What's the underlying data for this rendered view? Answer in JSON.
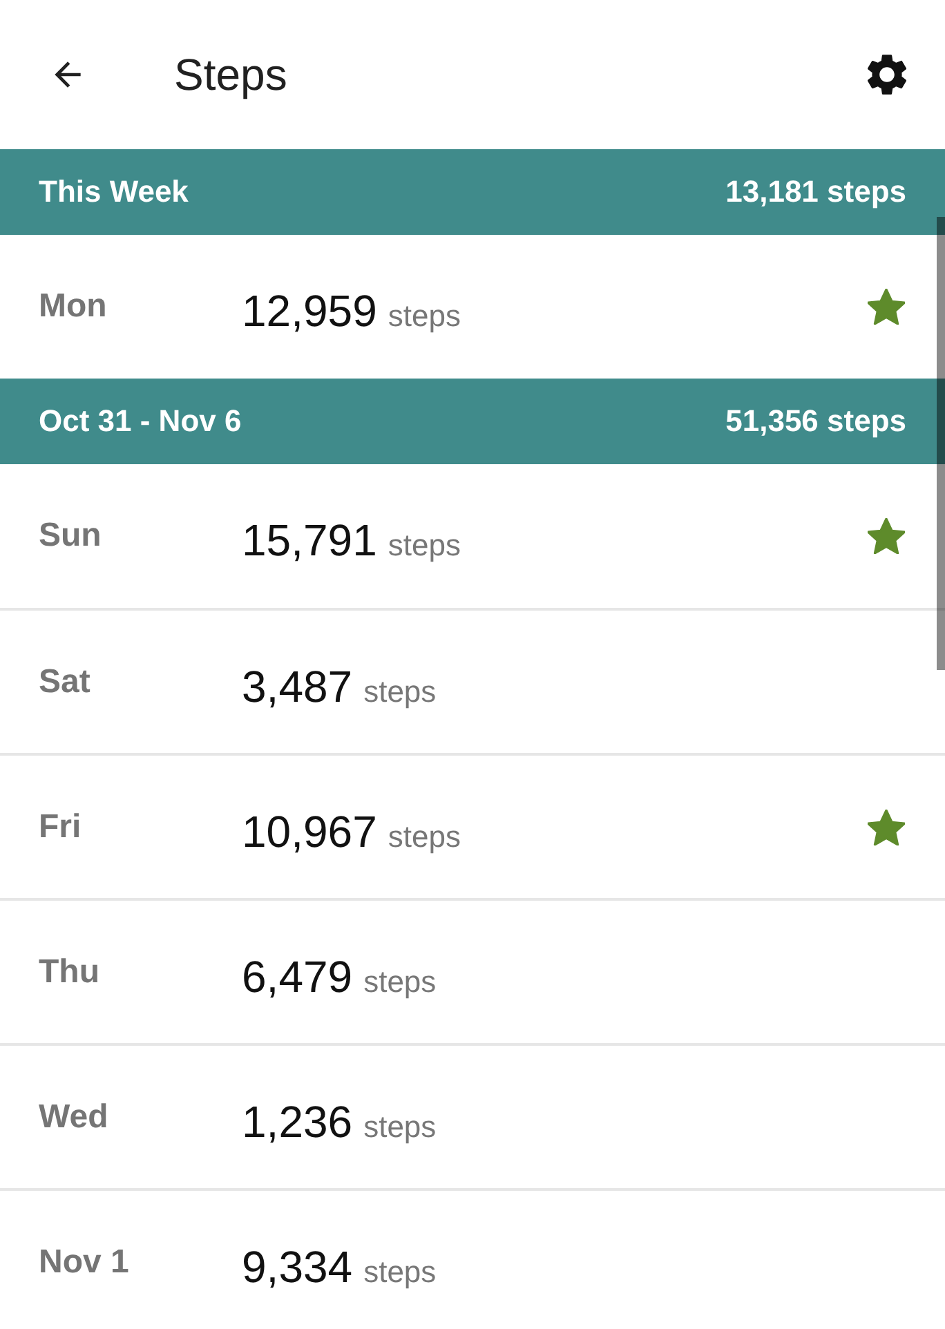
{
  "app_bar": {
    "title": "Steps"
  },
  "weeks": [
    {
      "label": "This Week",
      "total": "13,181 steps",
      "days": [
        {
          "day": "Mon",
          "count": "12,959",
          "unit": "steps",
          "starred": true
        }
      ]
    },
    {
      "label": "Oct 31 - Nov 6",
      "total": "51,356 steps",
      "days": [
        {
          "day": "Sun",
          "count": "15,791",
          "unit": "steps",
          "starred": true
        },
        {
          "day": "Sat",
          "count": "3,487",
          "unit": "steps",
          "starred": false
        },
        {
          "day": "Fri",
          "count": "10,967",
          "unit": "steps",
          "starred": true
        },
        {
          "day": "Thu",
          "count": "6,479",
          "unit": "steps",
          "starred": false
        },
        {
          "day": "Wed",
          "count": "1,236",
          "unit": "steps",
          "starred": false
        },
        {
          "day": "Nov 1",
          "count": "9,334",
          "unit": "steps",
          "starred": false
        }
      ]
    }
  ]
}
